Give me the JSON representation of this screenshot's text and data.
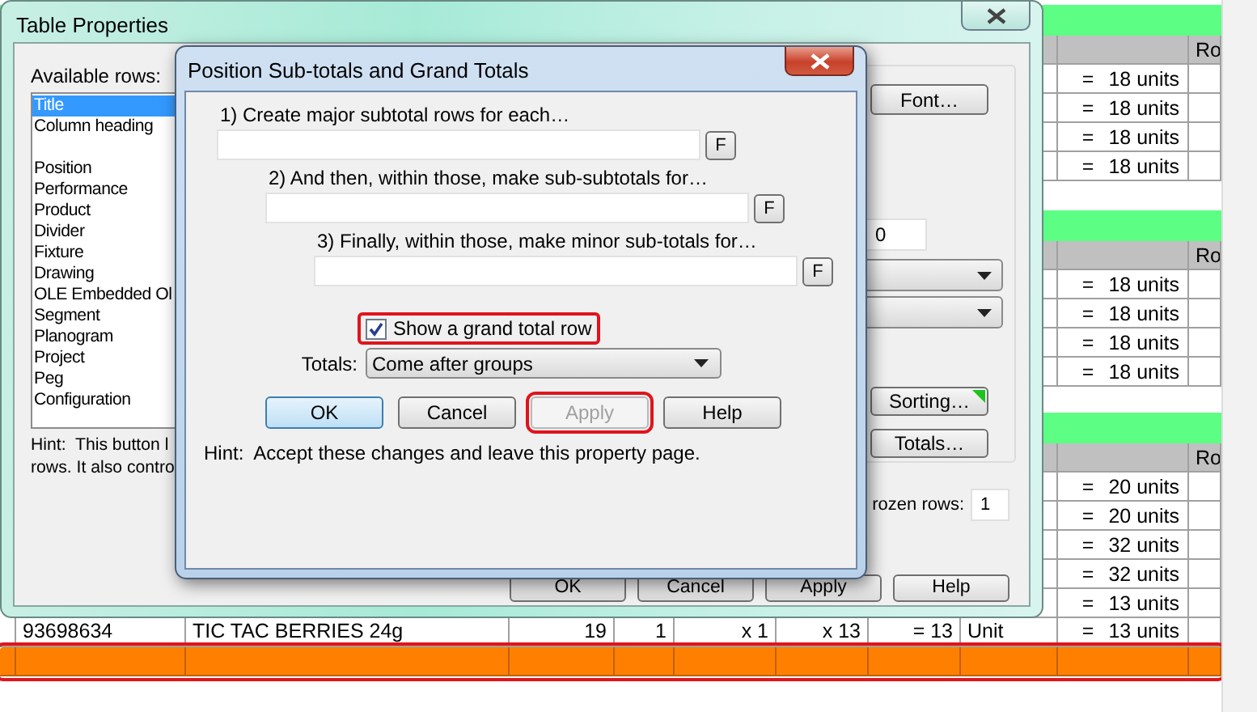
{
  "spreadsheet": {
    "sections": [
      {
        "header": "Ro",
        "rows": [
          {
            "kind": "units",
            "sign": "=",
            "value": "18 units"
          },
          {
            "kind": "units",
            "sign": "=",
            "value": "18 units"
          },
          {
            "kind": "units",
            "sign": "=",
            "value": "18 units"
          },
          {
            "kind": "units",
            "sign": "=",
            "value": "18 units"
          }
        ]
      },
      {
        "header": "Ro",
        "rows": [
          {
            "kind": "units",
            "sign": "=",
            "value": "18 units"
          },
          {
            "kind": "units",
            "sign": "=",
            "value": "18 units"
          },
          {
            "kind": "units",
            "sign": "=",
            "value": "18 units"
          },
          {
            "kind": "units",
            "sign": "=",
            "value": "18 units"
          }
        ]
      },
      {
        "header": "Ro",
        "rows": [
          {
            "kind": "units",
            "sign": "=",
            "value": "20 units"
          },
          {
            "kind": "units",
            "sign": "=",
            "value": "20 units"
          },
          {
            "kind": "units",
            "sign": "=",
            "value": "32 units"
          },
          {
            "kind": "units",
            "sign": "=",
            "value": "32 units"
          },
          {
            "kind": "units",
            "sign": "=",
            "value": "13 units"
          },
          {
            "kind": "item",
            "cells": [
              "93698634",
              "TIC TAC BERRIES 24g",
              "19",
              "1",
              "x 1",
              "x 13",
              "= 13",
              "Unit"
            ],
            "sign": "=",
            "value": "13 units"
          },
          {
            "kind": "total",
            "highlighted": true
          }
        ]
      }
    ]
  },
  "table_properties": {
    "title": "Table Properties",
    "available_rows_label": "Available rows:",
    "available_row_groups": [
      {
        "items": [
          {
            "label": "Title",
            "selected": true
          },
          {
            "label": "Column heading",
            "selected": false
          }
        ]
      },
      {
        "items": [
          {
            "label": "Position",
            "selected": false
          },
          {
            "label": "Performance",
            "selected": false
          },
          {
            "label": "Product",
            "selected": false
          },
          {
            "label": "Divider",
            "selected": false
          },
          {
            "label": "Fixture",
            "selected": false
          },
          {
            "label": "Drawing",
            "selected": false
          },
          {
            "label": "OLE Embedded Ol",
            "selected": false
          },
          {
            "label": "Segment",
            "selected": false
          },
          {
            "label": "Planogram",
            "selected": false
          },
          {
            "label": "Project",
            "selected": false
          },
          {
            "label": "Peg",
            "selected": false
          },
          {
            "label": "Configuration",
            "selected": false
          }
        ]
      }
    ],
    "hint_lines": [
      "Hint:  This button l",
      "rows. It also contro"
    ],
    "font_button": "Font…",
    "number_field": "0",
    "sorting_button": {
      "label": "Sorting…",
      "flagged": true
    },
    "totals_button": "Totals…",
    "frozen_rows_label": "rozen rows:",
    "frozen_rows_value": "1",
    "buttons": [
      "OK",
      "Cancel",
      "Apply",
      "Help"
    ]
  },
  "totals_dialog": {
    "title": "Position Sub-totals and Grand Totals",
    "levels": [
      {
        "label": "1) Create major subtotal rows for each…",
        "button": "F"
      },
      {
        "label": "2) And then, within those, make sub-subtotals for…",
        "button": "F"
      },
      {
        "label": "3) Finally, within those, make minor sub-totals for…",
        "button": "F"
      }
    ],
    "grand_total": {
      "label": "Show a grand total row",
      "checked": true,
      "highlighted": true
    },
    "totals_label": "Totals:",
    "totals_value": "Come after groups",
    "buttons": [
      {
        "label": "OK",
        "default": true,
        "disabled": false,
        "highlighted": false
      },
      {
        "label": "Cancel",
        "default": false,
        "disabled": false,
        "highlighted": false
      },
      {
        "label": "Apply",
        "default": false,
        "disabled": true,
        "highlighted": true
      },
      {
        "label": "Help",
        "default": false,
        "disabled": false,
        "highlighted": false
      }
    ],
    "hint": "Hint:  Accept these changes and leave this property page."
  }
}
